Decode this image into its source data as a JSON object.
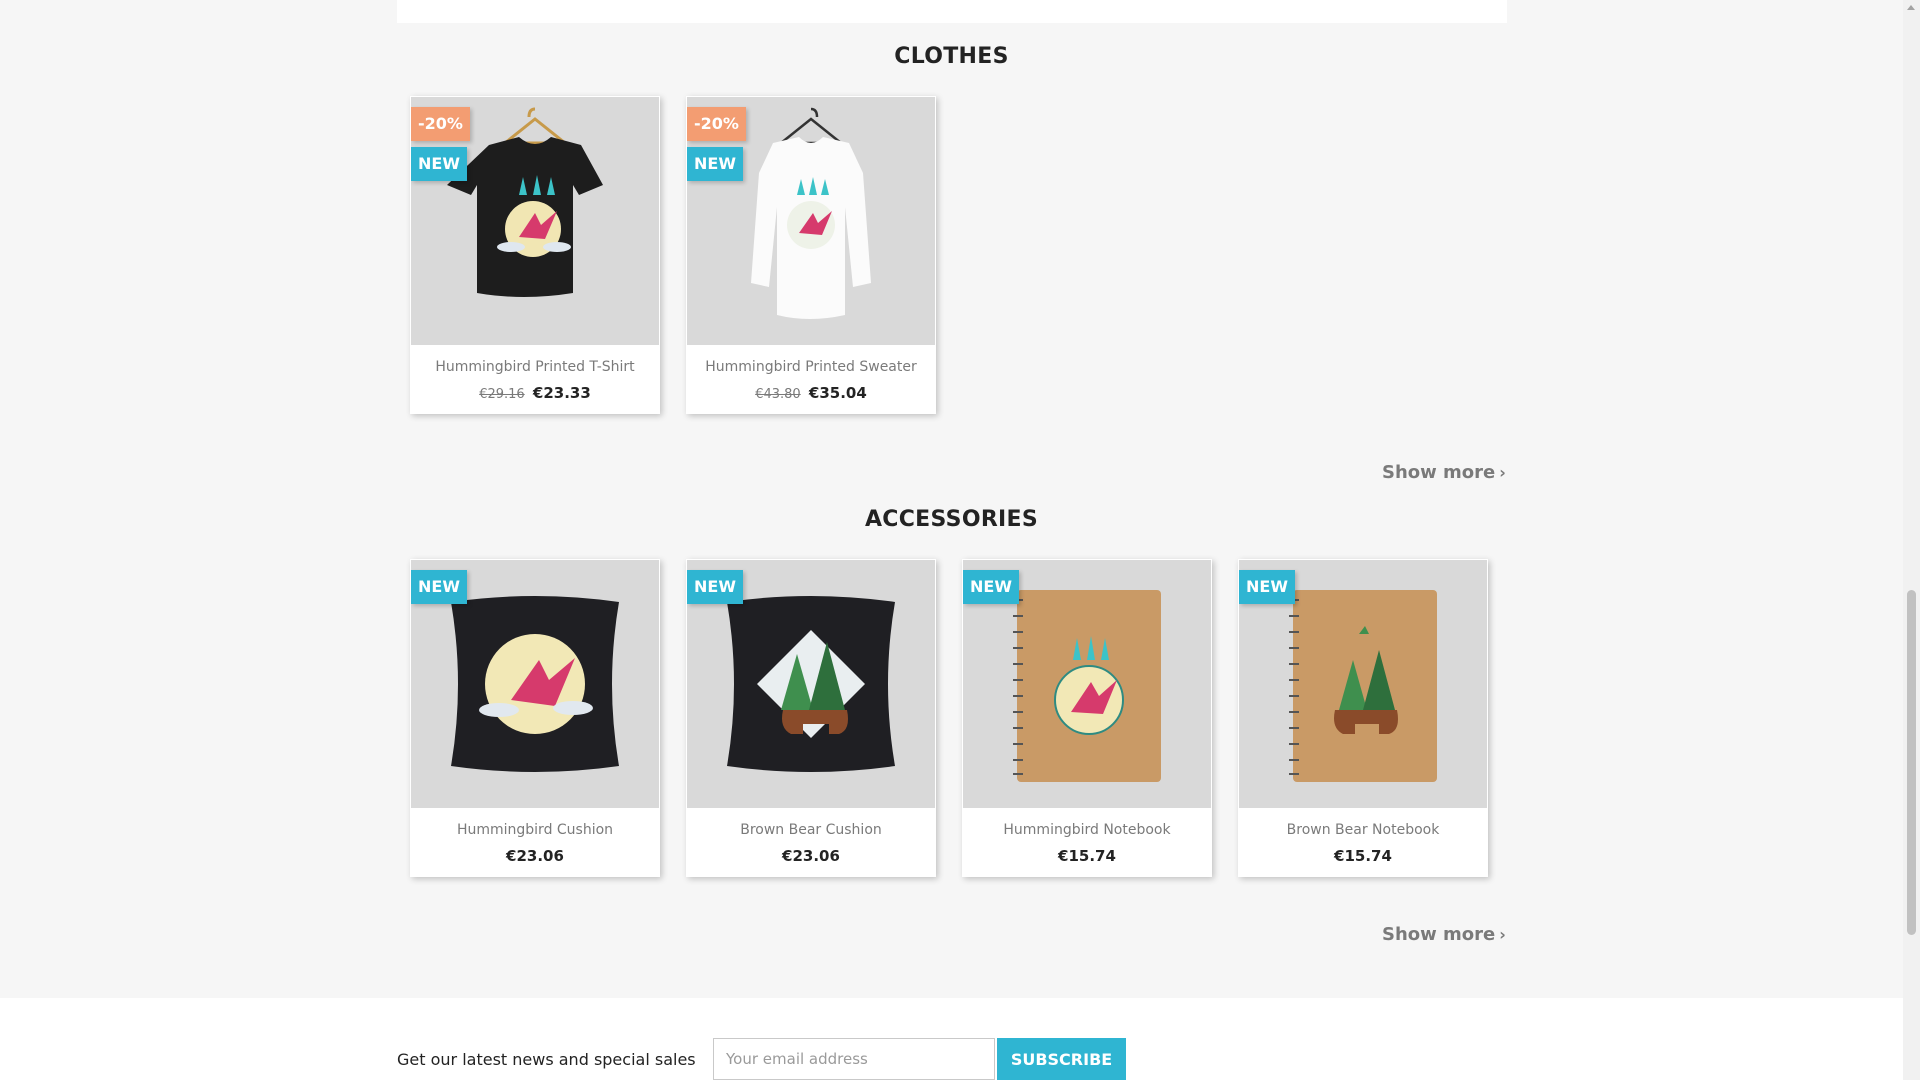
{
  "clothes": {
    "title": "CLOTHES",
    "products": [
      {
        "name": "Hummingbird Printed T-Shirt",
        "old_price": "€29.16",
        "price": "€23.33",
        "discount": "-20%",
        "new": "NEW"
      },
      {
        "name": "Hummingbird Printed Sweater",
        "old_price": "€43.80",
        "price": "€35.04",
        "discount": "-20%",
        "new": "NEW"
      }
    ],
    "show_more": "Show more"
  },
  "accessories": {
    "title": "ACCESSORIES",
    "products": [
      {
        "name": "Hummingbird Cushion",
        "price": "€23.06",
        "new": "NEW"
      },
      {
        "name": "Brown Bear Cushion",
        "price": "€23.06",
        "new": "NEW"
      },
      {
        "name": "Hummingbird Notebook",
        "price": "€15.74",
        "new": "NEW"
      },
      {
        "name": "Brown Bear Notebook",
        "price": "€15.74",
        "new": "NEW"
      }
    ],
    "show_more": "Show more"
  },
  "newsletter": {
    "text": "Get our latest news and special sales",
    "placeholder": "Your email address",
    "button": "Subscribe"
  },
  "colors": {
    "accent": "#2fb5d2",
    "discount": "#f39d72",
    "background": "#f6f6f6"
  },
  "icons": {
    "show_more": "chevron-right-icon"
  }
}
